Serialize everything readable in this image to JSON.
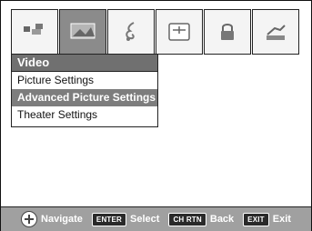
{
  "menu": {
    "title": "Video",
    "items": [
      {
        "label": "Picture Settings"
      },
      {
        "label": "Advanced Picture Settings"
      },
      {
        "label": "Theater Settings"
      }
    ],
    "selected_index": 1
  },
  "footer": {
    "navigate_label": "Navigate",
    "enter_key": "ENTER",
    "select_label": "Select",
    "chrtn_key": "CH RTN",
    "back_label": "Back",
    "exit_key": "EXIT",
    "exit_label": "Exit"
  },
  "tabs": [
    {
      "icon": "gallery-icon"
    },
    {
      "icon": "tv-picture-icon",
      "active": true
    },
    {
      "icon": "music-note-icon"
    },
    {
      "icon": "remote-control-icon"
    },
    {
      "icon": "lock-icon"
    },
    {
      "icon": "setup-icon"
    }
  ],
  "colors": {
    "active_tab": "#8b8b8b",
    "title_bar": "#707070",
    "selected_item": "#7d7d7d",
    "footer": "#a0a0a0"
  }
}
